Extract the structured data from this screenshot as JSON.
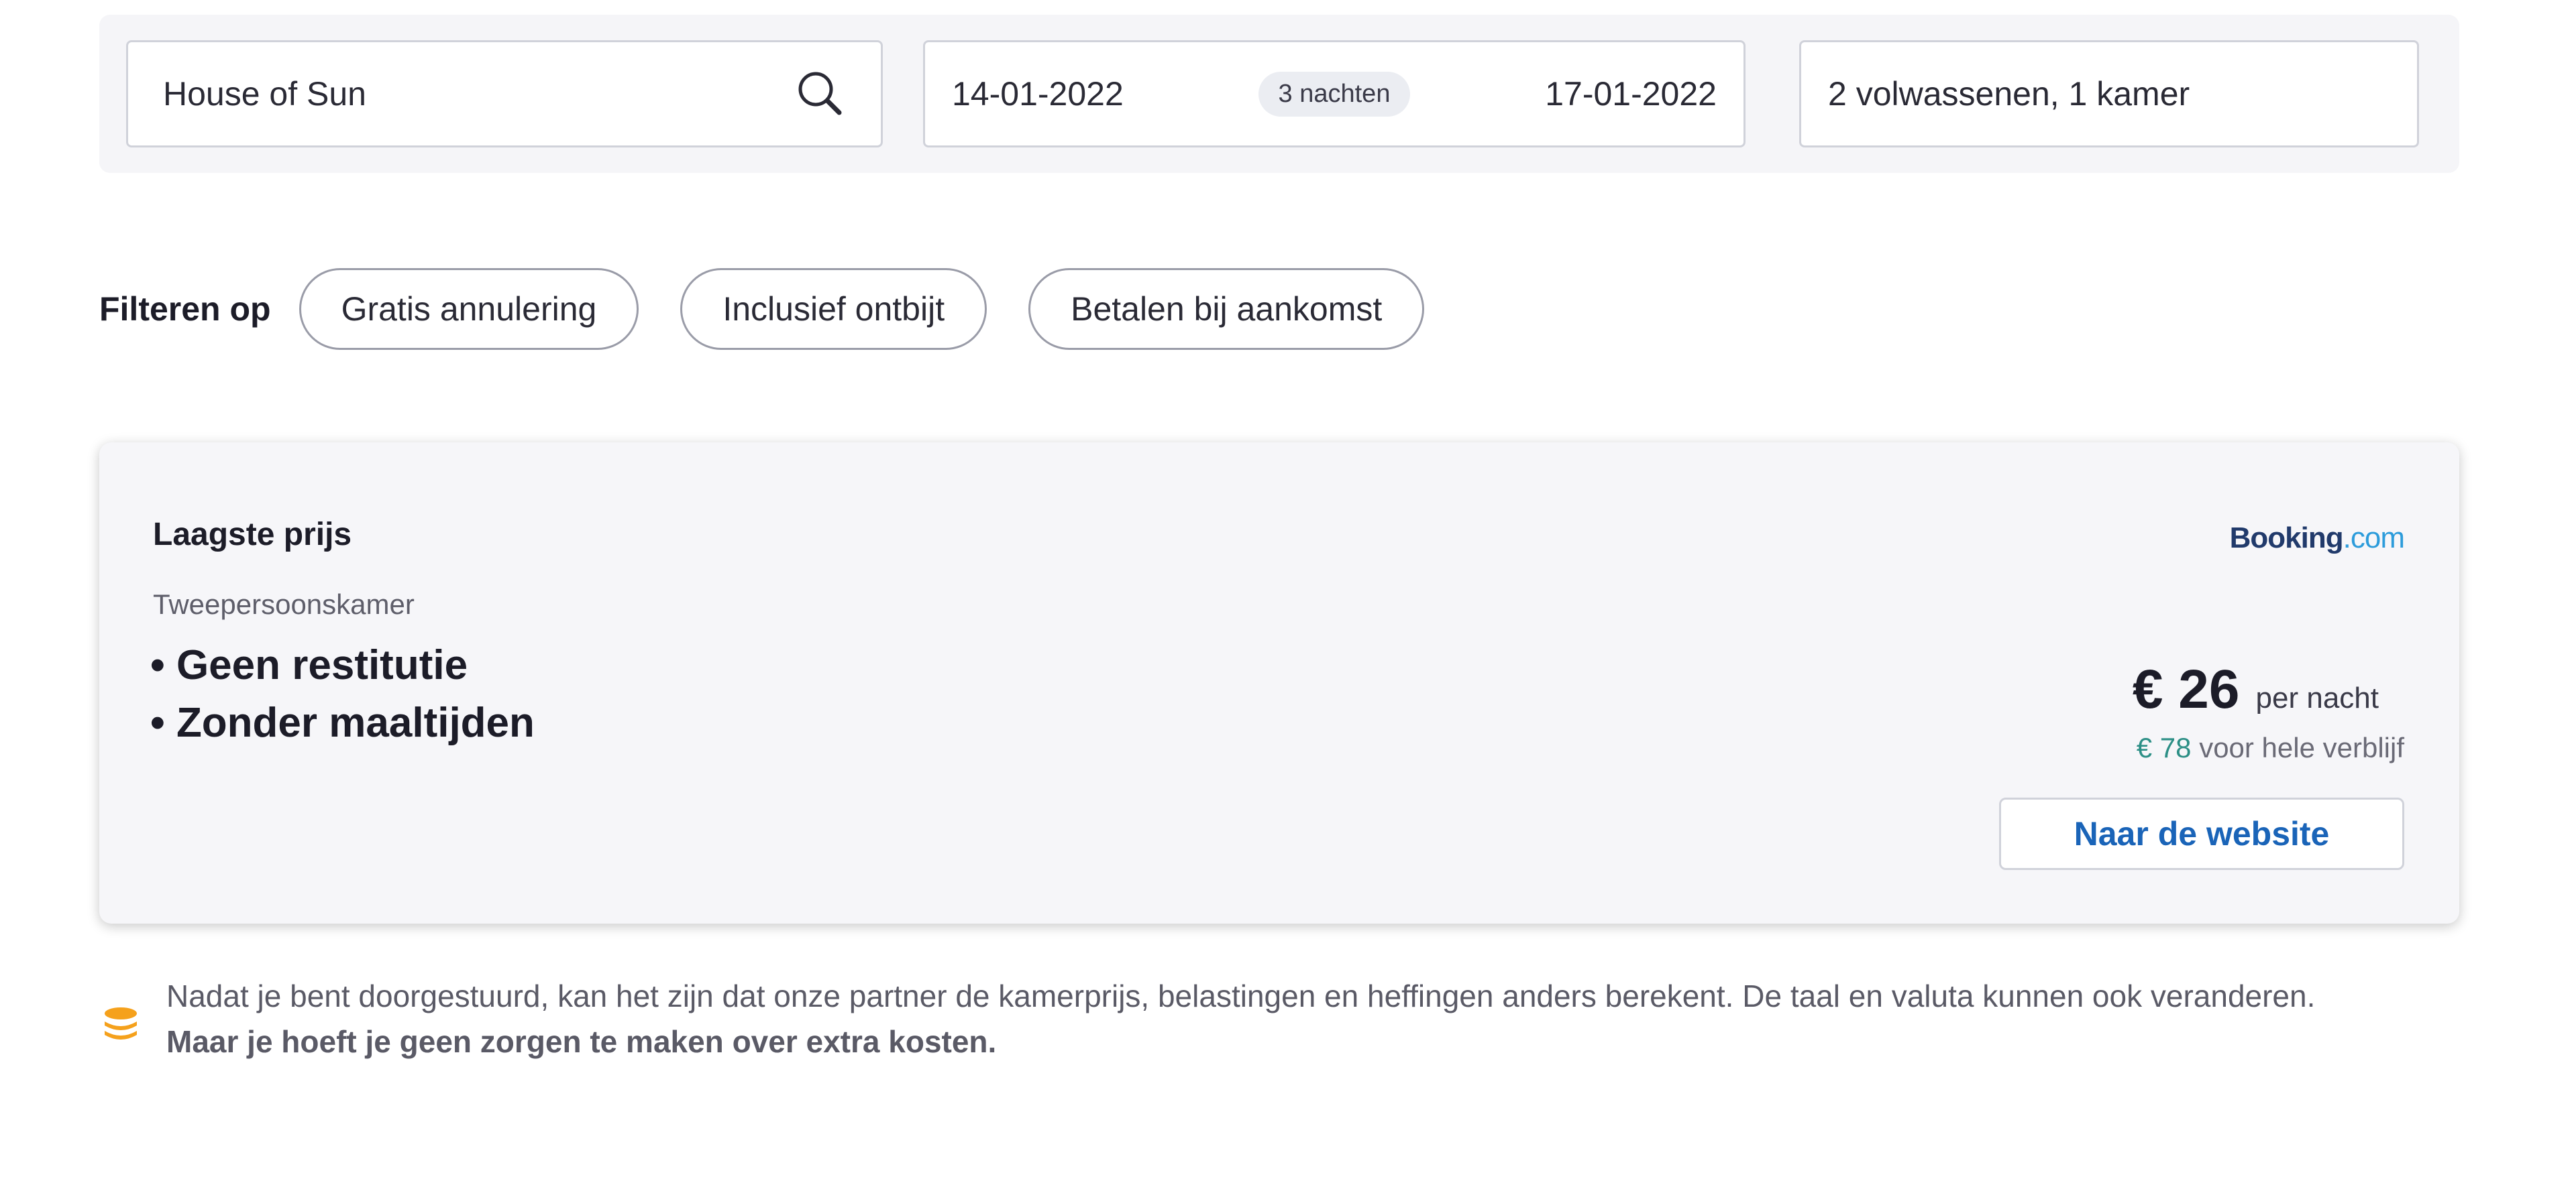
{
  "search": {
    "hotel_value": "House of Sun",
    "checkin": "14-01-2022",
    "nights_badge": "3 nachten",
    "checkout": "17-01-2022",
    "guests": "2 volwassenen, 1 kamer"
  },
  "filters": {
    "label": "Filteren op",
    "chips": [
      "Gratis annulering",
      "Inclusief ontbijt",
      "Betalen bij aankomst"
    ]
  },
  "offer": {
    "title": "Laagste prijs",
    "room_type": "Tweepersoonskamer",
    "features": [
      "Geen restitutie",
      "Zonder maaltijden"
    ],
    "provider": {
      "name_part1": "Booking",
      "name_part2": ".com"
    },
    "price": "€ 26",
    "price_unit": "per nacht",
    "total_price": "€ 78",
    "total_label": "voor hele verblijf",
    "button_label": "Naar de website"
  },
  "note": {
    "text": "Nadat je bent doorgestuurd, kan het zijn dat onze partner de kamerprijs, belastingen en heffingen anders berekent. De taal en valuta kunnen ook veranderen.",
    "bold": "Maar je hoeft je geen zorgen te maken over extra kosten."
  },
  "colors": {
    "accent_blue": "#1a64b8",
    "total_price_teal": "#2c8f86",
    "coins_icon_orange": "#f5a11c",
    "booking_dark": "#213a6b",
    "booking_light": "#2d9cdb"
  },
  "icons": {
    "search": "search-icon",
    "coins": "coins-icon"
  }
}
